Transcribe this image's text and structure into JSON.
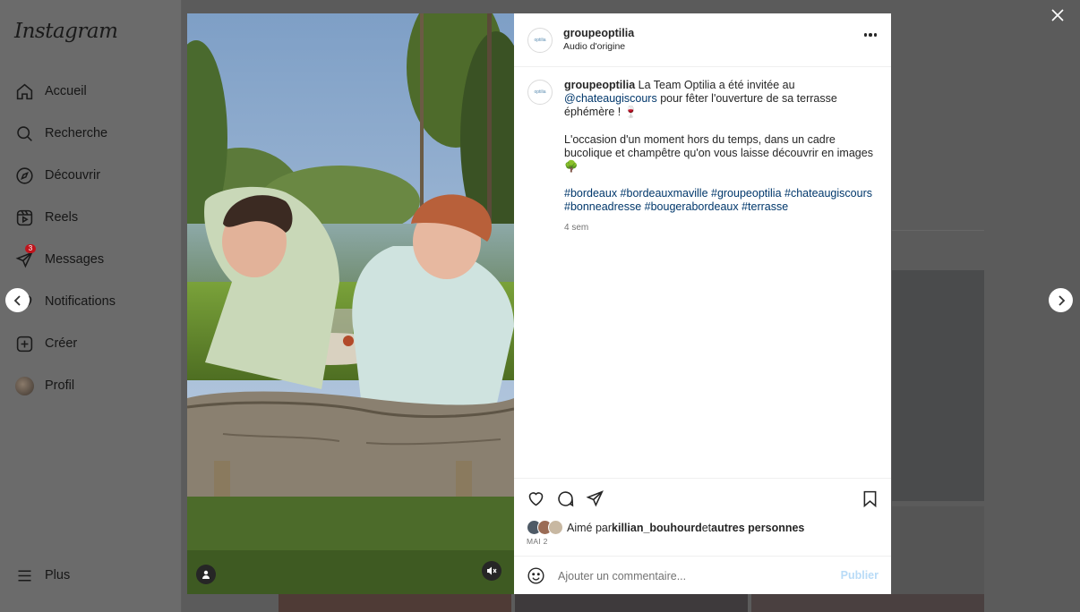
{
  "app": {
    "logo": "Instagram"
  },
  "sidebar": {
    "items": [
      {
        "label": "Accueil",
        "icon": "home-icon"
      },
      {
        "label": "Recherche",
        "icon": "search-icon"
      },
      {
        "label": "Découvrir",
        "icon": "compass-icon"
      },
      {
        "label": "Reels",
        "icon": "reels-icon"
      },
      {
        "label": "Messages",
        "icon": "messenger-icon",
        "badge": "3"
      },
      {
        "label": "Notifications",
        "icon": "heart-icon"
      },
      {
        "label": "Créer",
        "icon": "plus-square-icon"
      },
      {
        "label": "Profil",
        "icon": "avatar"
      }
    ],
    "more_label": "Plus"
  },
  "post": {
    "username": "groupeoptilia",
    "audio": "Audio d'origine",
    "avatar_text": "optilia",
    "caption": {
      "username": "groupeoptilia",
      "line1_pre": " La Team Optilia a été invitée au",
      "mention": "@chateaugiscours",
      "line1_post": " pour fêter l'ouverture de sa terrasse éphémère ! 🍷",
      "para2": "L'occasion d'un moment hors du temps, dans un cadre bucolique et champêtre qu'on vous laisse découvrir en images 🌳",
      "hashtags": "#bordeaux #bordeauxmaville #groupeoptilia #chateaugiscours #bonneadresse #bougerabordeaux #terrasse",
      "time": "4 sem"
    },
    "likes": {
      "prefix": "Aimé par ",
      "user": "killian_bouhourd",
      "mid": " et ",
      "suffix": "autres personnes"
    },
    "date": "MAI 2",
    "comment": {
      "placeholder": "Ajouter un commentaire...",
      "publish": "Publier"
    }
  },
  "colors": {
    "accent_link": "#00376b",
    "publish_disabled": "#b8dbf7",
    "badge": "#c0141c"
  }
}
